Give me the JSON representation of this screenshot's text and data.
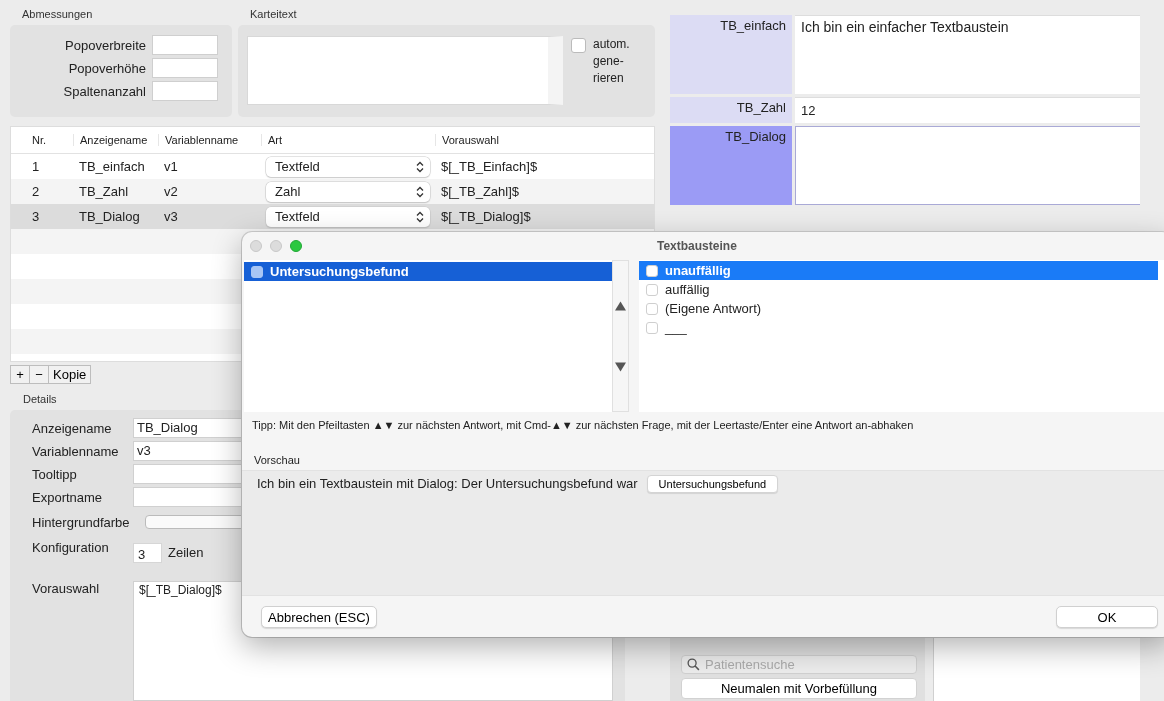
{
  "dimensions": {
    "title": "Abmessungen",
    "fields": [
      {
        "label": "Popoverbreite"
      },
      {
        "label": "Popoverhöhe"
      },
      {
        "label": "Spaltenanzahl"
      }
    ]
  },
  "card_text": {
    "title": "Karteitext",
    "auto_generate": {
      "lines": [
        "autom.",
        "gene-",
        "rieren"
      ],
      "checked": false
    }
  },
  "table": {
    "columns": [
      "Nr.",
      "Anzeigename",
      "Variablenname",
      "Art",
      "Vorauswahl"
    ],
    "rows": [
      {
        "nr": "1",
        "display_name": "TB_einfach",
        "variable": "v1",
        "type": "Textfeld",
        "preselection": "$[_TB_Einfach]$",
        "selected": false
      },
      {
        "nr": "2",
        "display_name": "TB_Zahl",
        "variable": "v2",
        "type": "Zahl",
        "preselection": "$[_TB_Zahl]$",
        "selected": false
      },
      {
        "nr": "3",
        "display_name": "TB_Dialog",
        "variable": "v3",
        "type": "Textfeld",
        "preselection": "$[_TB_Dialog]$",
        "selected": true
      }
    ]
  },
  "table_toolbar": [
    "+",
    "−",
    "Kopie"
  ],
  "details": {
    "title": "Details",
    "fields": [
      {
        "label": "Anzeigename",
        "kind": "text",
        "value": "TB_Dialog"
      },
      {
        "label": "Variablenname",
        "kind": "text",
        "value": "v3"
      },
      {
        "label": "Tooltipp",
        "kind": "text"
      },
      {
        "label": "Exportname",
        "kind": "text"
      },
      {
        "label": "Hintergrundfarbe",
        "kind": "color"
      },
      {
        "label": "Konfiguration",
        "kind": "rows",
        "value": "3",
        "unit": "Zeilen"
      },
      {
        "label": "Vorauswahl",
        "kind": "textarea",
        "value": "$[_TB_Dialog]$"
      }
    ]
  },
  "preview_fields": [
    {
      "label": "TB_einfach",
      "kind": "multiline",
      "value": "Ich bin ein einfacher Textbaustein",
      "selected": false
    },
    {
      "label": "TB_Zahl",
      "kind": "line",
      "value": "12",
      "selected": false
    },
    {
      "label": "TB_Dialog",
      "kind": "multiline",
      "selected": true
    }
  ],
  "patient_panel": {
    "search_placeholder": "Patientensuche",
    "button": "Neumalen mit Vorbefüllung"
  },
  "dialog": {
    "title": "Textbausteine",
    "questions": [
      {
        "label": "Untersuchungsbefund",
        "selected": true,
        "checked": false
      }
    ],
    "answers": [
      {
        "label": "unauffällig",
        "selected": true,
        "checked": false
      },
      {
        "label": "auffällig",
        "selected": false,
        "checked": false
      },
      {
        "label": "(Eigene Antwort)",
        "selected": false,
        "checked": false
      },
      {
        "label": "___",
        "selected": false,
        "checked": false
      }
    ],
    "tip": "Tipp: Mit den Pfeiltasten ▲▼ zur nächsten Antwort, mit Cmd-▲▼  zur nächsten Frage, mit der Leertaste/Enter eine Antwort an-abhaken",
    "preview_title": "Vorschau",
    "preview_text": "Ich bin ein Textbaustein mit Dialog: Der Untersuchungsbefund war",
    "preview_token": "Untersuchungsbefund",
    "cancel": "Abbrechen (ESC)",
    "ok": "OK"
  }
}
